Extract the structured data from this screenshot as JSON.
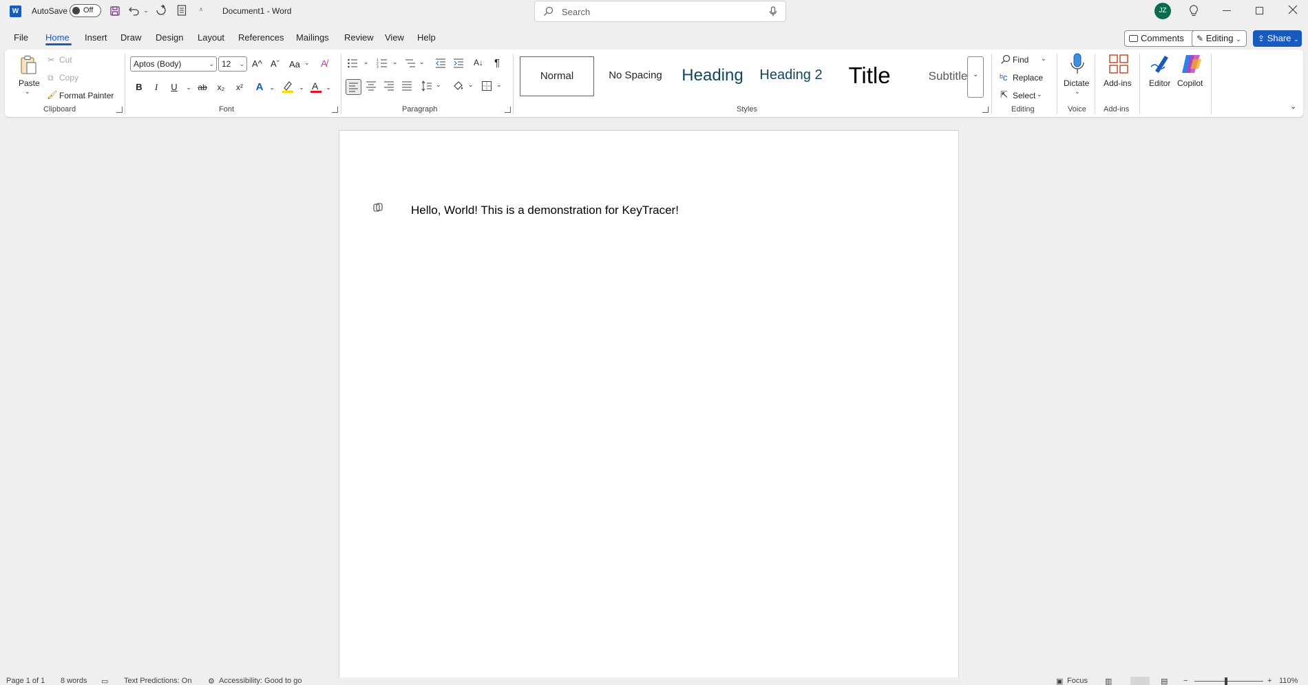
{
  "titlebar": {
    "app_icon": "word-logo-icon",
    "app_letter": "W",
    "autosave_label": "AutoSave",
    "autosave_state": "Off",
    "document_title": "Document1  -  Word",
    "search_placeholder": "Search",
    "avatar_initials": "JZ"
  },
  "tabs": [
    {
      "label": "File"
    },
    {
      "label": "Home"
    },
    {
      "label": "Insert"
    },
    {
      "label": "Draw"
    },
    {
      "label": "Design"
    },
    {
      "label": "Layout"
    },
    {
      "label": "References"
    },
    {
      "label": "Mailings"
    },
    {
      "label": "Review"
    },
    {
      "label": "View"
    },
    {
      "label": "Help"
    }
  ],
  "topright": {
    "comments": "Comments",
    "editing": "Editing",
    "share": "Share"
  },
  "clipboard": {
    "paste": "Paste",
    "cut": "Cut",
    "copy": "Copy",
    "format_painter": "Format Painter",
    "label": "Clipboard"
  },
  "font": {
    "name": "Aptos (Body)",
    "size": "12",
    "label": "Font",
    "bold": "B",
    "italic": "I",
    "underline": "U",
    "strike": "ab",
    "sub": "x₂",
    "sup": "x²",
    "grow": "A^",
    "shrink": "Aˇ",
    "case": "Aa"
  },
  "paragraph": {
    "label": "Paragraph",
    "pilcrow": "¶"
  },
  "styles": {
    "label": "Styles",
    "items": [
      {
        "label": "Normal"
      },
      {
        "label": "No Spacing"
      },
      {
        "label": "Heading"
      },
      {
        "label": "Heading 2"
      },
      {
        "label": "Title"
      },
      {
        "label": "Subtitle"
      }
    ]
  },
  "editing": {
    "label": "Editing",
    "find": "Find",
    "replace": "Replace",
    "select": "Select"
  },
  "voice": {
    "label": "Voice",
    "dictate": "Dictate"
  },
  "addins": {
    "label": "Add-ins",
    "addins": "Add-ins"
  },
  "editor": "Editor",
  "copilot": "Copilot",
  "document": {
    "text": "Hello, World! This is a demonstration for KeyTracer!"
  },
  "statusbar": {
    "page": "Page 1 of 1",
    "words": "8 words",
    "predictions": "Text Predictions: On",
    "accessibility": "Accessibility: Good to go",
    "focus": "Focus",
    "zoom": "110%"
  },
  "colors": {
    "accent": "#185abd",
    "highlight": "#ffd800",
    "font_color": "#e81123"
  }
}
